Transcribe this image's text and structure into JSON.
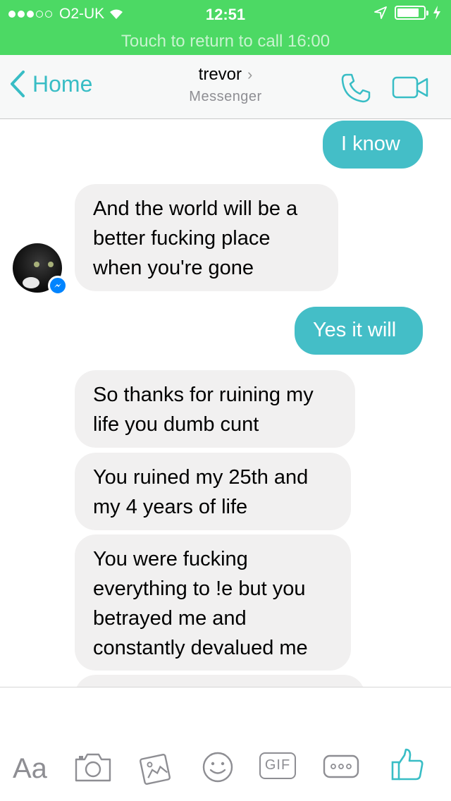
{
  "status_bar": {
    "carrier": "O2-UK",
    "time": "12:51"
  },
  "call_banner": "Touch to return to call 16:00",
  "nav": {
    "back_label": "Home",
    "contact_name": "trevor",
    "subtitle": "Messenger"
  },
  "messages": [
    {
      "from": "me",
      "text": "I know"
    },
    {
      "from": "them",
      "text": "And the world will be a better fucking place when you're gone"
    },
    {
      "from": "me",
      "text": "Yes it will"
    },
    {
      "from": "them",
      "text": "So thanks for ruining my life you dumb cunt"
    },
    {
      "from": "them",
      "text": "You ruined my 25th and my 4 years of life"
    },
    {
      "from": "them",
      "text": "You were fucking everything to !e but you betrayed me and constantly devalued me"
    }
  ],
  "composer": {
    "text_button": "Aa",
    "gif_label": "GIF"
  },
  "colors": {
    "status_green": "#4cd964",
    "accent_teal": "#44bec7",
    "incoming_bubble": "#f1f0f0",
    "messenger_blue": "#0084ff"
  },
  "icons": [
    "signal-icon",
    "wifi-icon",
    "location-icon",
    "battery-icon",
    "charging-icon",
    "back-chevron-icon",
    "phone-icon",
    "video-icon",
    "camera-icon",
    "photo-icon",
    "emoji-icon",
    "gif-icon",
    "more-icon",
    "like-icon"
  ]
}
